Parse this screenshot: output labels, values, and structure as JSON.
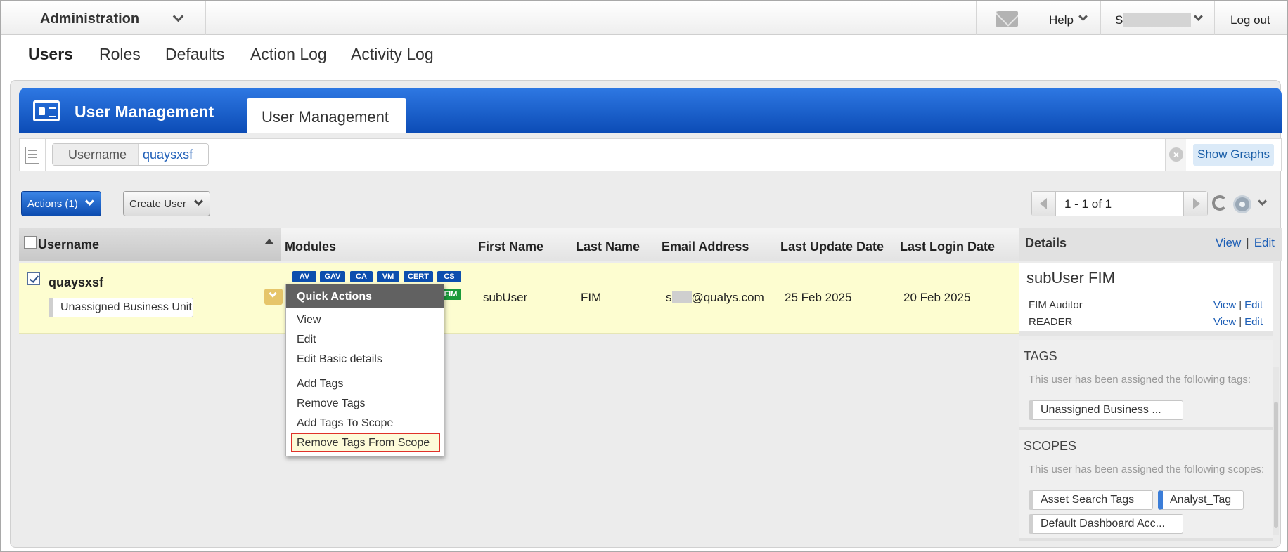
{
  "topbar": {
    "app_name": "Administration",
    "help_label": "Help",
    "user_initial": "S",
    "logout_label": "Log out"
  },
  "nav": {
    "items": [
      "Users",
      "Roles",
      "Defaults",
      "Action Log",
      "Activity Log"
    ],
    "active": "Users"
  },
  "banner": {
    "title": "User Management",
    "tab_label": "User Management"
  },
  "filter": {
    "field": "Username",
    "value": "quaysxsf",
    "show_graphs_label": "Show Graphs"
  },
  "toolbar": {
    "actions_label": "Actions (1)",
    "create_user_label": "Create User",
    "pager_text": "1 - 1 of 1"
  },
  "table": {
    "headers": [
      "Username",
      "Modules",
      "First Name",
      "Last Name",
      "Email Address",
      "Last Update Date",
      "Last Login Date"
    ],
    "row": {
      "checked": true,
      "username": "quaysxsf",
      "business_unit": "Unassigned Business Unit",
      "modules": [
        "AV",
        "GAV",
        "CA",
        "VM",
        "CERT",
        "CS",
        "FIM"
      ],
      "first_name": "subUser",
      "last_name": "FIM",
      "email_prefix": "s",
      "email_suffix": "@qualys.com",
      "last_update": "25 Feb 2025",
      "last_login": "20 Feb 2025"
    }
  },
  "quick_actions": {
    "title": "Quick Actions",
    "items": [
      "View",
      "Edit",
      "Edit Basic details",
      "Add Tags",
      "Remove Tags",
      "Add Tags To Scope",
      "Remove Tags From Scope"
    ],
    "highlighted": "Remove Tags From Scope"
  },
  "details": {
    "header": "Details",
    "view_label": "View",
    "edit_label": "Edit",
    "user_title": "subUser FIM",
    "roles": [
      {
        "name": "FIM Auditor",
        "view": "View",
        "edit": "Edit"
      },
      {
        "name": "READER",
        "view": "View",
        "edit": "Edit"
      }
    ],
    "tags": {
      "heading": "TAGS",
      "desc": "This user has been assigned the following tags:",
      "items": [
        "Unassigned Business ..."
      ]
    },
    "scopes": {
      "heading": "SCOPES",
      "desc": "This user has been assigned the following scopes:",
      "items": [
        "Asset Search Tags",
        "Analyst_Tag",
        "Default Dashboard Acc..."
      ]
    }
  },
  "colors": {
    "banner_blue": "#0c4cb6",
    "row_highlight": "#fdfdd0",
    "module_blue": "#0d4fae",
    "module_green": "#1a9a3a",
    "highlight_border": "#e0312a",
    "link_blue": "#1e5fb6"
  }
}
